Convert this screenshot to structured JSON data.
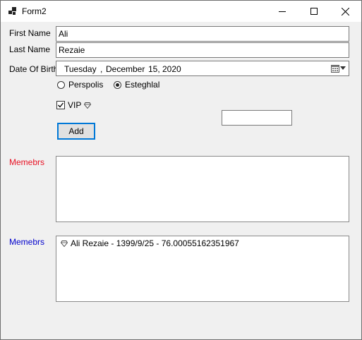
{
  "window": {
    "title": "Form2"
  },
  "colors": {
    "members_label_1": "#e81123",
    "members_label_2": "#0000cc",
    "focus_border": "#0078d7"
  },
  "form": {
    "first_name_label": "First Name",
    "first_name_value": "Ali",
    "last_name_label": "Last Name",
    "last_name_value": "Rezaie",
    "dob_label": "Date Of Birth",
    "dob_weekday": "Tuesday",
    "dob_sep": ",",
    "dob_month": "December",
    "dob_day": "15,",
    "dob_year": "2020",
    "radio_options": [
      {
        "label": "Perspolis",
        "checked": false
      },
      {
        "label": "Esteghlal",
        "checked": true
      }
    ],
    "vip_label": "VIP",
    "vip_checked": true,
    "vip_icon": "diamond-icon",
    "extra_input_value": "",
    "add_button_label": "Add"
  },
  "members_list_1": {
    "label": "Memebrs",
    "items": []
  },
  "members_list_2": {
    "label": "Memebrs",
    "items": [
      {
        "icon": "diamond-icon",
        "text": "Ali Rezaie - 1399/9/25 - 76.00055162351967"
      }
    ]
  }
}
